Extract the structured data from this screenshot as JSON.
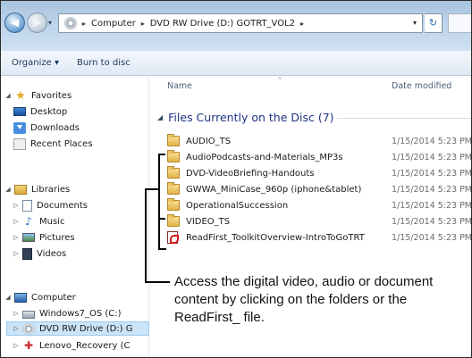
{
  "address_bar": {
    "recent_dropdown": "▾",
    "breadcrumbs": [
      "Computer",
      "DVD RW Drive (D:) GOTRT_VOL2"
    ],
    "separators": [
      "▸",
      "▸",
      "▸"
    ],
    "dropdown": "▾",
    "refresh": "↻"
  },
  "toolbar": {
    "organize_label": "Organize ▾",
    "burn_label": "Burn to disc"
  },
  "sidebar": {
    "favorites": {
      "label": "Favorites",
      "items": [
        {
          "label": "Desktop",
          "icon": "desktop-icon"
        },
        {
          "label": "Downloads",
          "icon": "downloads-icon"
        },
        {
          "label": "Recent Places",
          "icon": "recent-places-icon"
        }
      ]
    },
    "libraries": {
      "label": "Libraries",
      "items": [
        {
          "label": "Documents",
          "icon": "documents-icon"
        },
        {
          "label": "Music",
          "icon": "music-icon"
        },
        {
          "label": "Pictures",
          "icon": "pictures-icon"
        },
        {
          "label": "Videos",
          "icon": "videos-icon"
        }
      ]
    },
    "computer": {
      "label": "Computer",
      "items": [
        {
          "label": "Windows7_OS (C:)",
          "icon": "hard-drive-icon"
        },
        {
          "label": "DVD RW Drive (D:) G",
          "icon": "dvd-drive-icon",
          "selected": true
        },
        {
          "label": "Lenovo_Recovery (C",
          "icon": "recovery-drive-icon"
        }
      ]
    }
  },
  "columns": {
    "name": "Name",
    "date_modified": "Date modified"
  },
  "group": {
    "title": "Files Currently on the Disc (7)"
  },
  "files": [
    {
      "name": "AUDIO_TS",
      "date": "1/15/2014 5:23 PM",
      "type": "folder"
    },
    {
      "name": "AudioPodcasts-and-Materials_MP3s",
      "date": "1/15/2014 5:23 PM",
      "type": "folder"
    },
    {
      "name": "DVD-VideoBriefing-Handouts",
      "date": "1/15/2014 5:23 PM",
      "type": "folder"
    },
    {
      "name": "GWWA_MiniCase_960p (iphone&tablet)",
      "date": "1/15/2014 5:23 PM",
      "type": "folder"
    },
    {
      "name": "OperationalSuccession",
      "date": "1/15/2014 5:23 PM",
      "type": "folder"
    },
    {
      "name": "VIDEO_TS",
      "date": "1/15/2014 5:23 PM",
      "type": "folder"
    },
    {
      "name": "ReadFirst_ToolkitOverview-IntroToGoTRT",
      "date": "1/15/2014 5:23 PM",
      "type": "pdf"
    }
  ],
  "callout": {
    "text": "Access the digital video, audio or document content by clicking on the folders or the ReadFirst_ file."
  },
  "colors": {
    "group_title": "#1e3287",
    "selection": "#cce4f7",
    "toolbar_text": "#1e395b"
  }
}
